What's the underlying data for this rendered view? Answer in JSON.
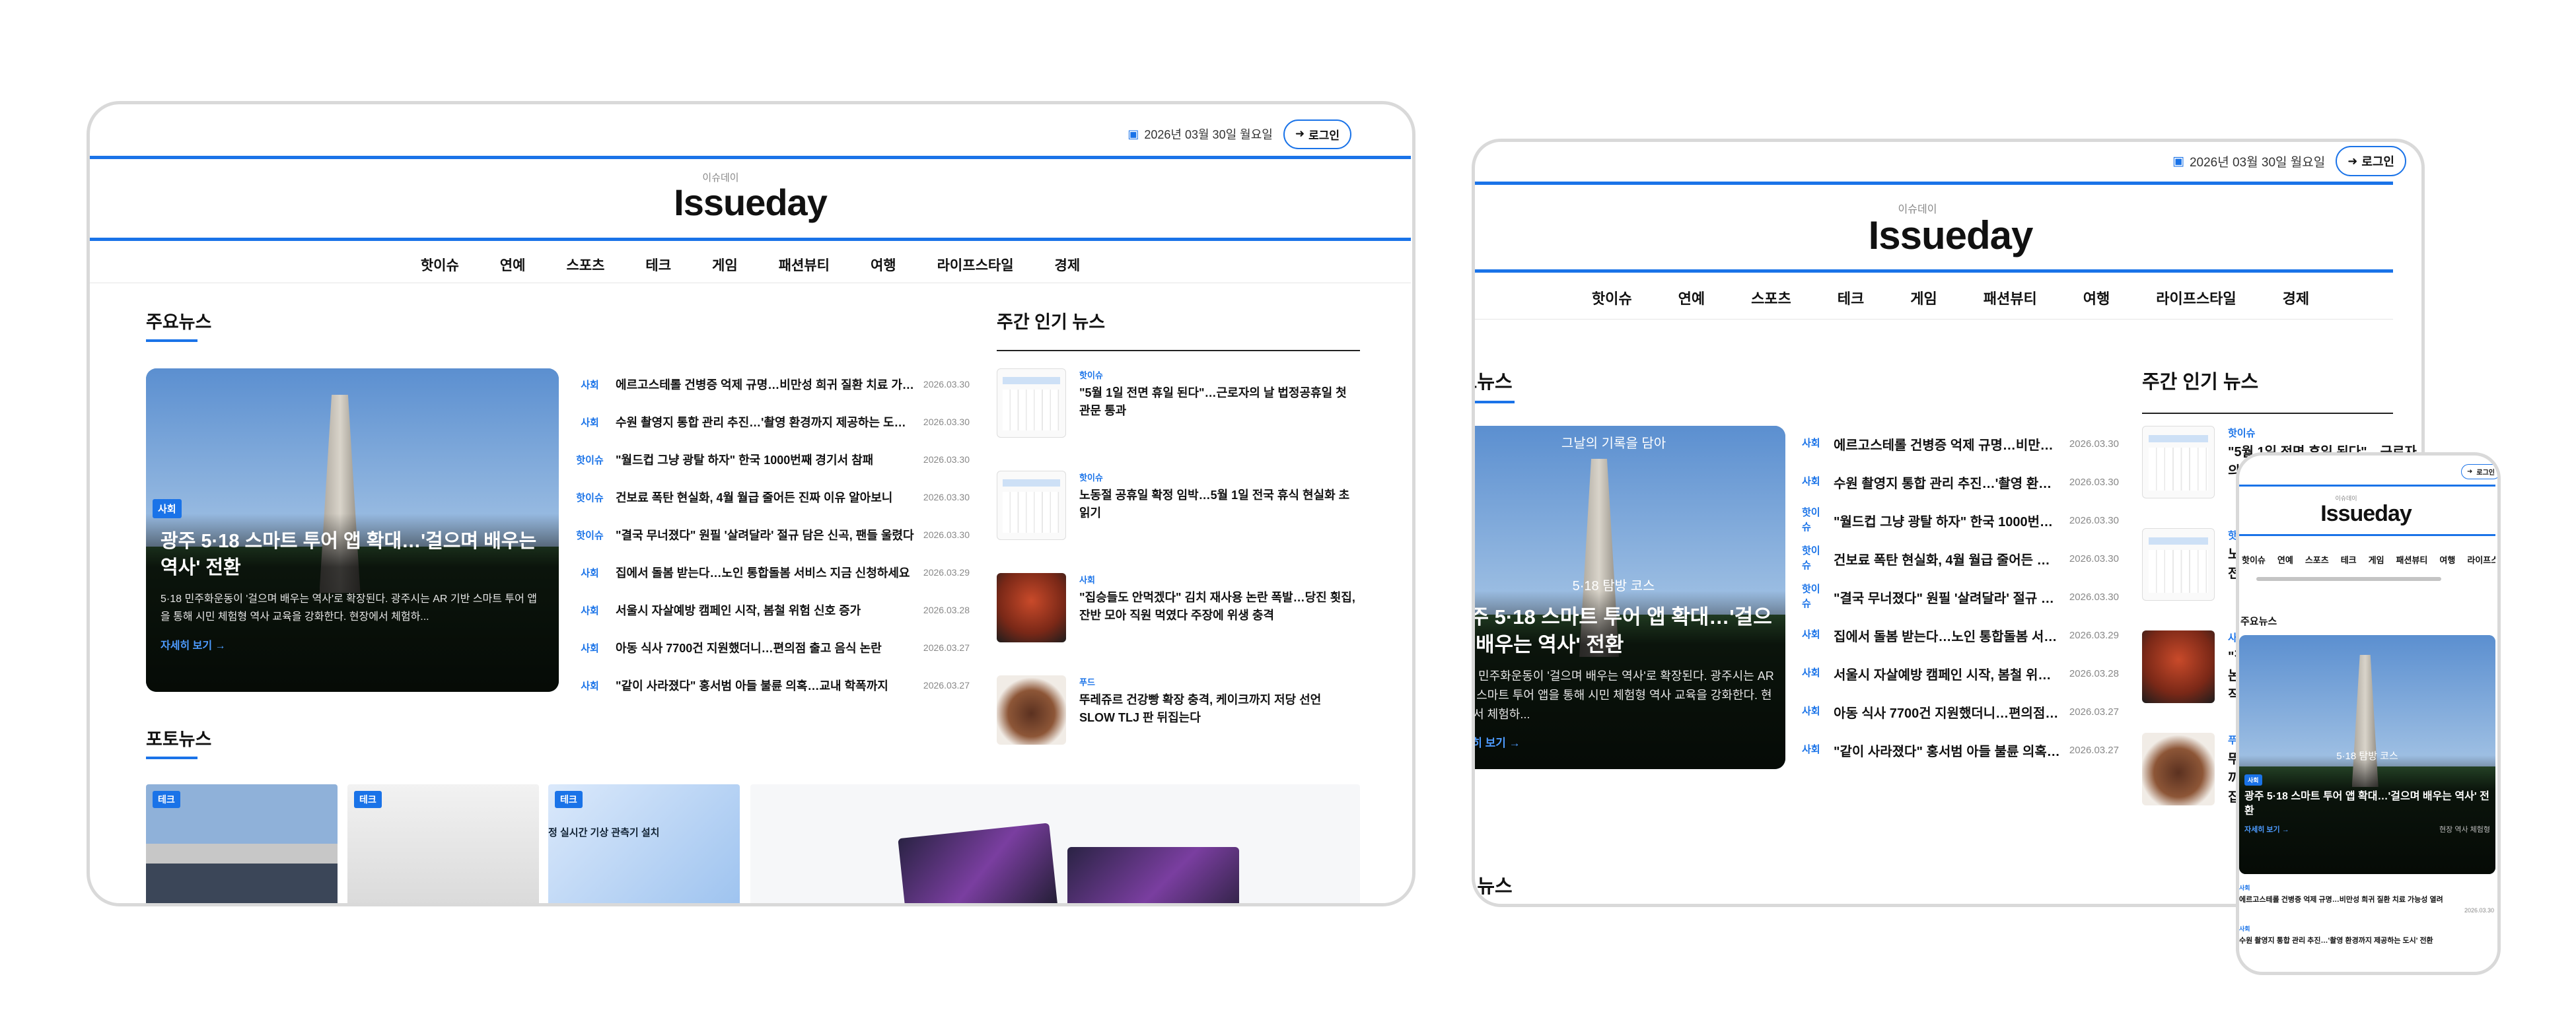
{
  "site": {
    "small_logo": "이슈데이",
    "logo": "Issueday"
  },
  "header": {
    "date": "2026년 03월 30일 월요일",
    "login": "로그인"
  },
  "nav": [
    "핫이슈",
    "연예",
    "스포츠",
    "테크",
    "게임",
    "패션뷰티",
    "여행",
    "라이프스타일",
    "경제"
  ],
  "sections": {
    "main": "주요뉴스",
    "weekly": "주간 인기 뉴스",
    "photo": "포토뉴스"
  },
  "hero": {
    "tag": "사회",
    "title": "광주 5·18 스마트 투어 앱 확대…'걸으며 배우는 역사' 전환",
    "desc": "5·18 민주화운동이 '걸으며 배우는 역사'로 확장된다. 광주시는 AR 기반 스마트 투어 앱을 통해 시민 체험형 역사 교육을 강화한다. 현장에서 체험하...",
    "more": "자세히 보기 →",
    "image_text_a": "그날의 기록을 담아",
    "image_text_b": "5·18 탐방 코스",
    "image_text_c": "현장 역사 체험형"
  },
  "news_list": [
    {
      "cat": "사회",
      "title": "에르고스테롤 건병증 억제 규명…비만성 희귀 질환 치료 가능성 열려",
      "date": "2026.03.30"
    },
    {
      "cat": "사회",
      "title": "수원 촬영지 통합 관리 추진…'촬영 환경까지 제공하는 도시' 전환",
      "date": "2026.03.30"
    },
    {
      "cat": "핫이슈",
      "title": "\"월드컵 그냥 광탈 하자\" 한국 1000번째 경기서 참패",
      "date": "2026.03.30"
    },
    {
      "cat": "핫이슈",
      "title": "건보료 폭탄 현실화, 4월 월급 줄어든 진짜 이유 알아보니",
      "date": "2026.03.30"
    },
    {
      "cat": "핫이슈",
      "title": "\"결국 무너졌다\" 원필 '살려달라' 절규 담은 신곡, 팬들 울렸다",
      "date": "2026.03.30"
    },
    {
      "cat": "사회",
      "title": "집에서 돌봄 받는다…노인 통합돌봄 서비스 지금 신청하세요",
      "date": "2026.03.29"
    },
    {
      "cat": "사회",
      "title": "서울시 자살예방 캠페인 시작, 봄철 위험 신호 증가",
      "date": "2026.03.28"
    },
    {
      "cat": "사회",
      "title": "아동 식사 7700건 지원했더니…편의점 출고 음식 논란",
      "date": "2026.03.27"
    },
    {
      "cat": "사회",
      "title": "\"같이 사라졌다\" 홍서범 아들 불륜 의혹…교내 학폭까지",
      "date": "2026.03.27"
    }
  ],
  "weekly": [
    {
      "cat": "핫이슈",
      "title": "\"5월 1일 전면 휴일 된다\"…근로자의 날 법정공휴일 첫 관문 통과",
      "thumb": "calendar"
    },
    {
      "cat": "핫이슈",
      "title": "노동절 공휴일 확정 임박…5월 1일 전국 휴식 현실화 초읽기",
      "thumb": "calendar"
    },
    {
      "cat": "사회",
      "title": "\"집승들도 안먹겠다\" 김치 재사용 논란 폭발…당진 횟집, 잔반 모아 직원 먹였다 주장에 위생 충격",
      "thumb": "kimchi"
    },
    {
      "cat": "푸드",
      "title": "뚜레쥬르 건강빵 확장 충격, 케이크까지 저당 선언 SLOW TLJ 판 뒤집는다",
      "thumb": "cake"
    }
  ],
  "photos": [
    {
      "tag": "테크"
    },
    {
      "tag": "테크"
    },
    {
      "tag": "테크",
      "caption": "정 실시간 기상 관측기 설치"
    }
  ],
  "mobile_list": [
    {
      "cat": "사회",
      "title": "에르고스테롤 건병증 억제 규명…비만성 희귀 질환 치료 가능성 열려",
      "date": "2026.03.30"
    },
    {
      "cat": "사회",
      "title": "수원 촬영지 통합 관리 추진…'촬영 환경까지 제공하는 도시' 전환",
      "date": ""
    }
  ],
  "colors": {
    "accent": "#1a73e8",
    "text": "#111111",
    "muted": "#888888"
  }
}
